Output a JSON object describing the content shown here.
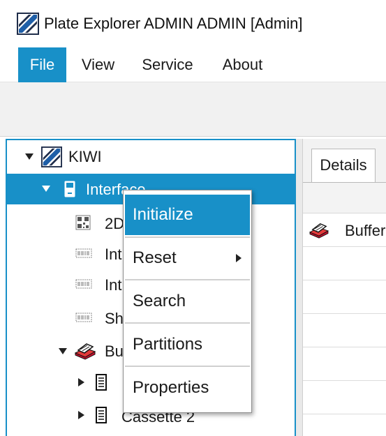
{
  "window": {
    "title": "Plate Explorer ADMIN ADMIN [Admin]"
  },
  "menu": [
    {
      "label": "File",
      "active": true
    },
    {
      "label": "View",
      "active": false
    },
    {
      "label": "Service",
      "active": false
    },
    {
      "label": "About",
      "active": false
    }
  ],
  "tree": {
    "root": {
      "label": "KIWI",
      "icon": "kiwi-logo-icon"
    },
    "interface": {
      "label": "Interface",
      "icon": "device-icon"
    },
    "children": [
      {
        "label": "2D",
        "icon": "barcode-2d-icon"
      },
      {
        "label": "Int",
        "icon": "barcode-1d-icon"
      },
      {
        "label": "Int",
        "icon": "barcode-1d-icon"
      },
      {
        "label": "She",
        "icon": "barcode-1d-icon"
      }
    ],
    "buffer": {
      "label": "Bu",
      "icon": "buffer-icon"
    },
    "cassettes": [
      {
        "label": "",
        "icon": "cassette-icon"
      },
      {
        "label": "Cassette 2",
        "icon": "cassette-icon"
      }
    ]
  },
  "details": {
    "tab_label": "Details",
    "rows": [
      {
        "label": "Buffer",
        "icon": "buffer-icon"
      }
    ]
  },
  "context_menu": {
    "items": [
      {
        "label": "Initialize",
        "highlighted": true,
        "submenu": false
      },
      {
        "label": "Reset",
        "highlighted": false,
        "submenu": true
      },
      {
        "label": "Search",
        "highlighted": false,
        "submenu": false
      },
      {
        "label": "Partitions",
        "highlighted": false,
        "submenu": false
      },
      {
        "label": "Properties",
        "highlighted": false,
        "submenu": false
      }
    ]
  },
  "colors": {
    "accent": "#1890c8"
  }
}
